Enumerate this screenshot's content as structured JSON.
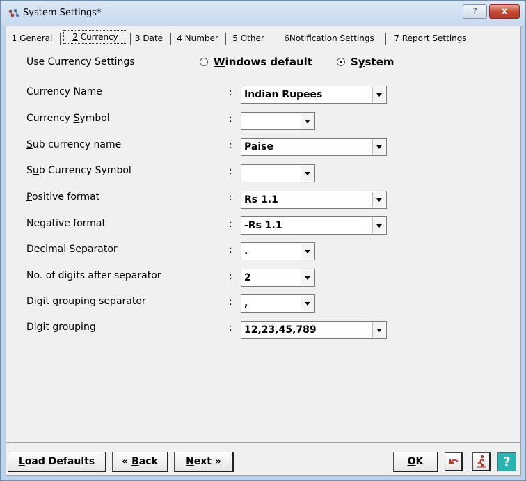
{
  "window": {
    "title": "System Settings*",
    "help_glyph": "?",
    "close_glyph": "x",
    "icon": "app-logo-icon"
  },
  "tabs": [
    {
      "key": "1",
      "label": " General"
    },
    {
      "key": "2",
      "label": " Currency"
    },
    {
      "key": "3",
      "label": " Date"
    },
    {
      "key": "4",
      "label": " Number"
    },
    {
      "key": "5",
      "label": " Other"
    },
    {
      "key": "6",
      "label": "Notification Settings"
    },
    {
      "key": "7",
      "label": " Report Settings"
    }
  ],
  "use_currency": {
    "label": "Use Currency Settings",
    "options": [
      {
        "label": "Windows default",
        "mnemonic": "W",
        "rest": "indows default",
        "selected": false
      },
      {
        "label": "System",
        "mnemonic": "y",
        "pre": "S",
        "rest": "stem",
        "selected": true
      }
    ]
  },
  "fields": [
    {
      "pre": "",
      "mn": "",
      "post": "Currency Name",
      "value": "Indian Rupees"
    },
    {
      "pre": "Currency ",
      "mn": "S",
      "post": "ymbol",
      "value": ""
    },
    {
      "pre": "",
      "mn": "S",
      "post": "ub currency name",
      "value": "Paise"
    },
    {
      "pre": "S",
      "mn": "u",
      "post": "b Currency Symbol",
      "value": ""
    },
    {
      "pre": "",
      "mn": "P",
      "post": "ositive format",
      "value": "Rs 1.1"
    },
    {
      "pre": "Negative format",
      "mn": "",
      "post": "",
      "value": "-Rs 1.1"
    },
    {
      "pre": "",
      "mn": "D",
      "post": "ecimal Separator",
      "value": "."
    },
    {
      "pre": "No. of di",
      "mn": "g",
      "post": "its after separator",
      "value": "2"
    },
    {
      "pre": "Digit ",
      "mn": "g",
      "post": "rouping separator",
      "value": ","
    },
    {
      "pre": "Digit g",
      "mn": "r",
      "post": "ouping",
      "value": "12,23,45,789"
    }
  ],
  "colon": ":",
  "footer": {
    "load_defaults": {
      "mn": "L",
      "rest": "oad Defaults"
    },
    "back": {
      "pre": "« ",
      "mn": "B",
      "rest": "ack"
    },
    "next": {
      "mn": "N",
      "rest": "ext »"
    },
    "ok": {
      "mn": "O",
      "rest": "K"
    },
    "help": "?"
  }
}
